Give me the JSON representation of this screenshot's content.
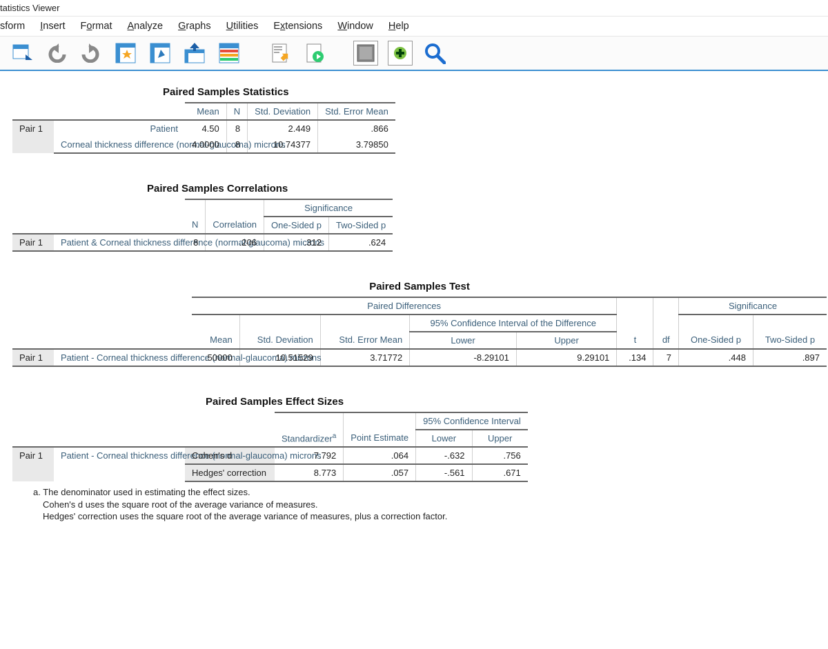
{
  "window": {
    "title": "tatistics Viewer"
  },
  "menu": {
    "transform": "sform",
    "insert": "Insert",
    "format": "Format",
    "analyze": "Analyze",
    "graphs": "Graphs",
    "utilities": "Utilities",
    "extensions": "Extensions",
    "window": "Window",
    "help": "Help"
  },
  "tables": {
    "stats": {
      "title": "Paired Samples Statistics",
      "cols": {
        "mean": "Mean",
        "n": "N",
        "sd": "Std. Deviation",
        "sem": "Std. Error Mean"
      },
      "pairlbl": "Pair 1",
      "r1": {
        "name": "Patient",
        "mean": "4.50",
        "n": "8",
        "sd": "2.449",
        "sem": ".866"
      },
      "r2": {
        "name": "Corneal thickness difference (normal-glaucoma) microns",
        "mean": "4.0000",
        "n": "8",
        "sd": "10.74377",
        "sem": "3.79850"
      }
    },
    "corr": {
      "title": "Paired Samples Correlations",
      "group": "Significance",
      "cols": {
        "n": "N",
        "corr": "Correlation",
        "p1": "One-Sided p",
        "p2": "Two-Sided p"
      },
      "pairlbl": "Pair 1",
      "row": {
        "name": "Patient & Corneal thickness difference (normal-glaucoma) microns",
        "n": "8",
        "corr": ".206",
        "p1": ".312",
        "p2": ".624"
      }
    },
    "test": {
      "title": "Paired Samples Test",
      "group_pd": "Paired Differences",
      "group_ci": "95% Confidence Interval of the Difference",
      "group_sig": "Significance",
      "cols": {
        "mean": "Mean",
        "sd": "Std. Deviation",
        "sem": "Std. Error Mean",
        "lower": "Lower",
        "upper": "Upper",
        "t": "t",
        "df": "df",
        "p1": "One-Sided p",
        "p2": "Two-Sided p"
      },
      "pairlbl": "Pair 1",
      "row": {
        "name": "Patient - Corneal thickness difference (normal-glaucoma) microns",
        "mean": ".50000",
        "sd": "10.51529",
        "sem": "3.71772",
        "lower": "-8.29101",
        "upper": "9.29101",
        "t": ".134",
        "df": "7",
        "p1": ".448",
        "p2": ".897"
      }
    },
    "es": {
      "title": "Paired Samples Effect Sizes",
      "group_ci": "95% Confidence Interval",
      "cols": {
        "std": "Standardizer",
        "pe": "Point Estimate",
        "lower": "Lower",
        "upper": "Upper"
      },
      "pairlbl": "Pair 1",
      "rowvar": "Patient - Corneal thickness difference (normal-glaucoma) microns",
      "r1": {
        "name": "Cohen's d",
        "std": "7.792",
        "pe": ".064",
        "lower": "-.632",
        "upper": ".756"
      },
      "r2": {
        "name": "Hedges' correction",
        "std": "8.773",
        "pe": ".057",
        "lower": "-.561",
        "upper": ".671"
      },
      "foot_a": "a. The denominator used in estimating the effect sizes.",
      "foot_b": "Cohen's d uses the square root of the average variance of measures.",
      "foot_c": "Hedges' correction uses the square root of the average variance of measures, plus a correction factor."
    }
  }
}
